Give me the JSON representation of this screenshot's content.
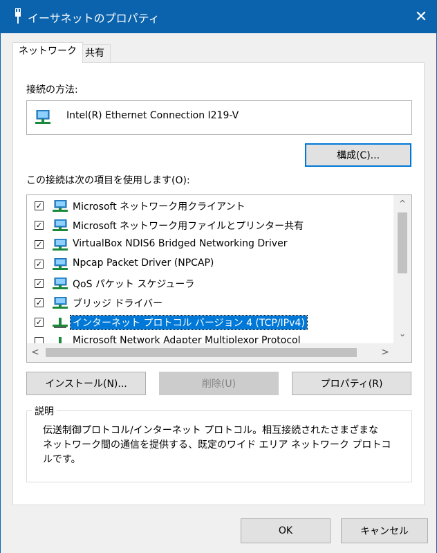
{
  "window": {
    "title": "イーサネットのプロパティ",
    "close_glyph": "✕"
  },
  "tabs": [
    {
      "label": "ネットワーク",
      "active": true
    },
    {
      "label": "共有",
      "active": false
    }
  ],
  "connect_using": {
    "label": "接続の方法:",
    "adapter_name": "Intel(R) Ethernet Connection I219-V",
    "configure_button": "構成(C)..."
  },
  "items": {
    "label": "この接続は次の項目を使用します(O):",
    "list": [
      {
        "label": "Microsoft ネットワーク用クライアント",
        "checked": true,
        "icon": "network-client-icon"
      },
      {
        "label": "Microsoft ネットワーク用ファイルとプリンター共有",
        "checked": true,
        "icon": "network-service-icon"
      },
      {
        "label": "VirtualBox NDIS6 Bridged Networking Driver",
        "checked": true,
        "icon": "network-service-icon"
      },
      {
        "label": "Npcap Packet Driver (NPCAP)",
        "checked": true,
        "icon": "network-service-icon"
      },
      {
        "label": "QoS パケット スケジューラ",
        "checked": true,
        "icon": "network-service-icon"
      },
      {
        "label": "ブリッジ ドライバー",
        "checked": true,
        "icon": "network-service-icon"
      },
      {
        "label": "インターネット プロトコル バージョン 4 (TCP/IPv4)",
        "checked": true,
        "selected": true,
        "icon": "protocol-icon"
      },
      {
        "label": "Microsoft Network Adapter Multiplexor Protocol",
        "checked": false,
        "icon": "protocol-icon"
      }
    ],
    "scroll_up": "^",
    "scroll_down": "⌄",
    "scroll_left": "<",
    "scroll_right": ">"
  },
  "actions": {
    "install": "インストール(N)...",
    "uninstall": "削除(U)",
    "properties": "プロパティ(R)"
  },
  "description": {
    "caption": "説明",
    "text": "伝送制御プロトコル/インターネット プロトコル。相互接続されたさまざまな\nネットワーク間の通信を提供する、既定のワイド エリア ネットワーク プロトコ\nルです。"
  },
  "footer": {
    "ok": "OK",
    "cancel": "キャンセル"
  },
  "colors": {
    "titlebar": "#0b63ad",
    "selection": "#0078d7",
    "focus_border": "#0078d7"
  }
}
